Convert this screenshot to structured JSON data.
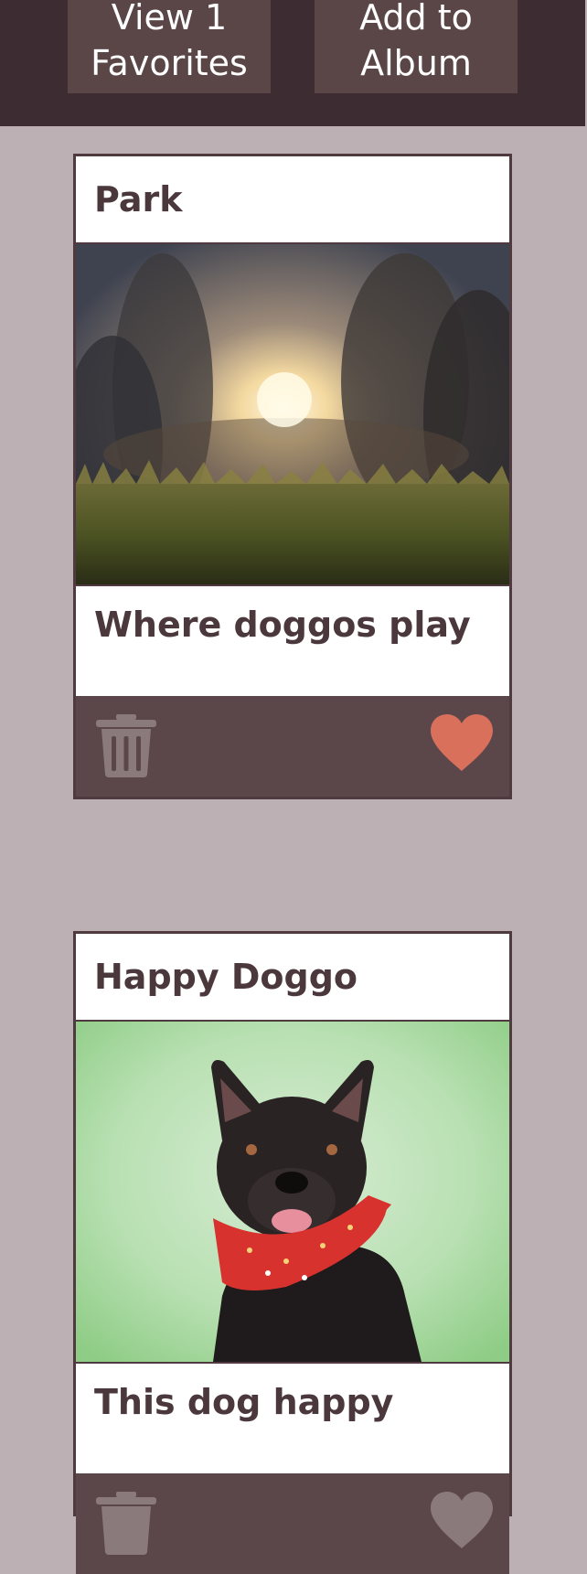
{
  "toolbar": {
    "view_favorites_label_line1": "View 1",
    "view_favorites_label_line2": "Favorites",
    "add_to_album_label_line1": "Add to",
    "add_to_album_label_line2": "Album"
  },
  "cards": [
    {
      "title": "Park",
      "caption": "Where doggos play",
      "image_subject": "sunset-park-grass",
      "favorited": true,
      "heart_color": "#d8705c",
      "trash_color": "#8a7a7c"
    },
    {
      "title": "Happy Doggo",
      "caption": "This dog happy",
      "image_subject": "black-dog-red-bandana",
      "favorited": false,
      "heart_color": "#8a7a7c",
      "trash_color": "#8a7a7c"
    }
  ],
  "colors": {
    "topbar_bg": "#3e2c33",
    "button_bg": "#5a4547",
    "page_bg": "#bdb0b4",
    "card_border": "#4e3a3f",
    "title_text": "#4b383d",
    "actions_bg": "#5b474a"
  }
}
